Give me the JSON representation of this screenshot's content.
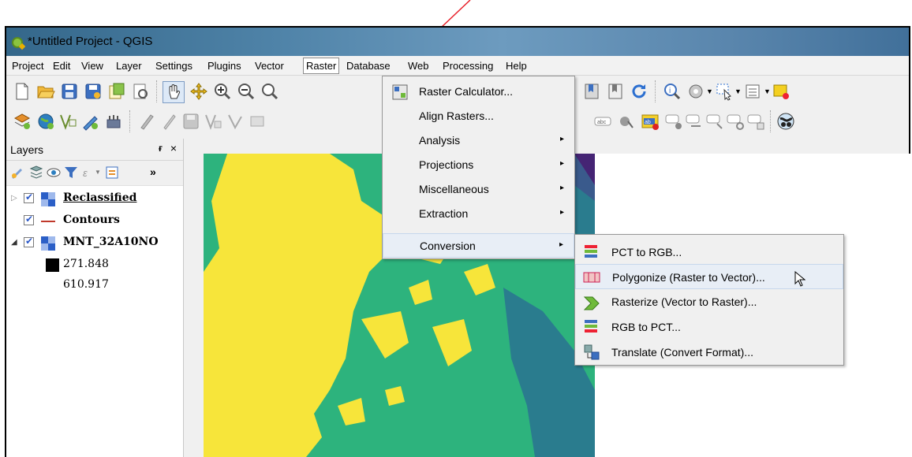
{
  "window": {
    "title": "*Untitled Project - QGIS"
  },
  "menubar": [
    "Project",
    "Edit",
    "View",
    "Layer",
    "Settings",
    "Plugins",
    "Vector",
    "Raster",
    "Database",
    "Web",
    "Processing",
    "Help"
  ],
  "menubar_active": "Raster",
  "layers_panel": {
    "title": "Layers",
    "float_label": "ғ",
    "close_label": "×",
    "overflow_label": "»",
    "layers": [
      {
        "name": "Reclassified",
        "checked": true,
        "expanded": false
      },
      {
        "name": "Contours",
        "checked": true
      },
      {
        "name": "MNT_32A10NO",
        "checked": true,
        "expanded": true
      }
    ],
    "legend": {
      "min": "271.848",
      "max": "610.917"
    }
  },
  "raster_menu": {
    "items": [
      "Raster Calculator...",
      "Align Rasters...",
      "Analysis",
      "Projections",
      "Miscellaneous",
      "Extraction",
      "Conversion"
    ],
    "submenu_arrow": "▸"
  },
  "conversion_menu": {
    "items": [
      "PCT to RGB...",
      "Polygonize (Raster to Vector)...",
      "Rasterize (Vector to Raster)...",
      "RGB to PCT...",
      "Translate (Convert Format)..."
    ],
    "hovered": "Polygonize (Raster to Vector)..."
  },
  "colors": {
    "annotation_arrow": "#e8202a",
    "map_yellow": "#f7e53a",
    "map_green": "#2db37d",
    "map_teal": "#2a7c8e",
    "map_blue": "#3a5a8c",
    "map_purple": "#452474"
  }
}
